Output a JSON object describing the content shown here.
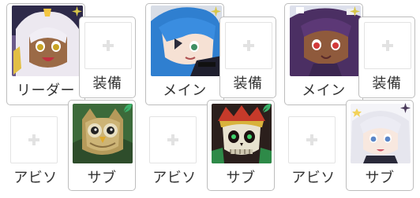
{
  "party": {
    "slots": [
      {
        "role_label": "リーダー",
        "equip_label": "装備"
      },
      {
        "role_label": "メイン",
        "equip_label": "装備"
      },
      {
        "role_label": "メイン",
        "equip_label": "装備"
      }
    ],
    "subs": [
      {
        "abiso_label": "アビソ",
        "sub_label": "サブ"
      },
      {
        "abiso_label": "アビソ",
        "sub_label": "サブ"
      },
      {
        "abiso_label": "アビソ",
        "sub_label": "サブ"
      }
    ]
  },
  "colors": {
    "border": "#bdbdbd",
    "placeholder": "#e2e2e2",
    "sparkle": "#d7c64a",
    "leaf": "#3bb26b",
    "text": "#333333"
  },
  "icons": {
    "empty_slot": "plus-icon",
    "rarity_badge": "sparkle-icon",
    "element_badge": "leaf-icon",
    "dark_badge": "dark-star-icon"
  }
}
